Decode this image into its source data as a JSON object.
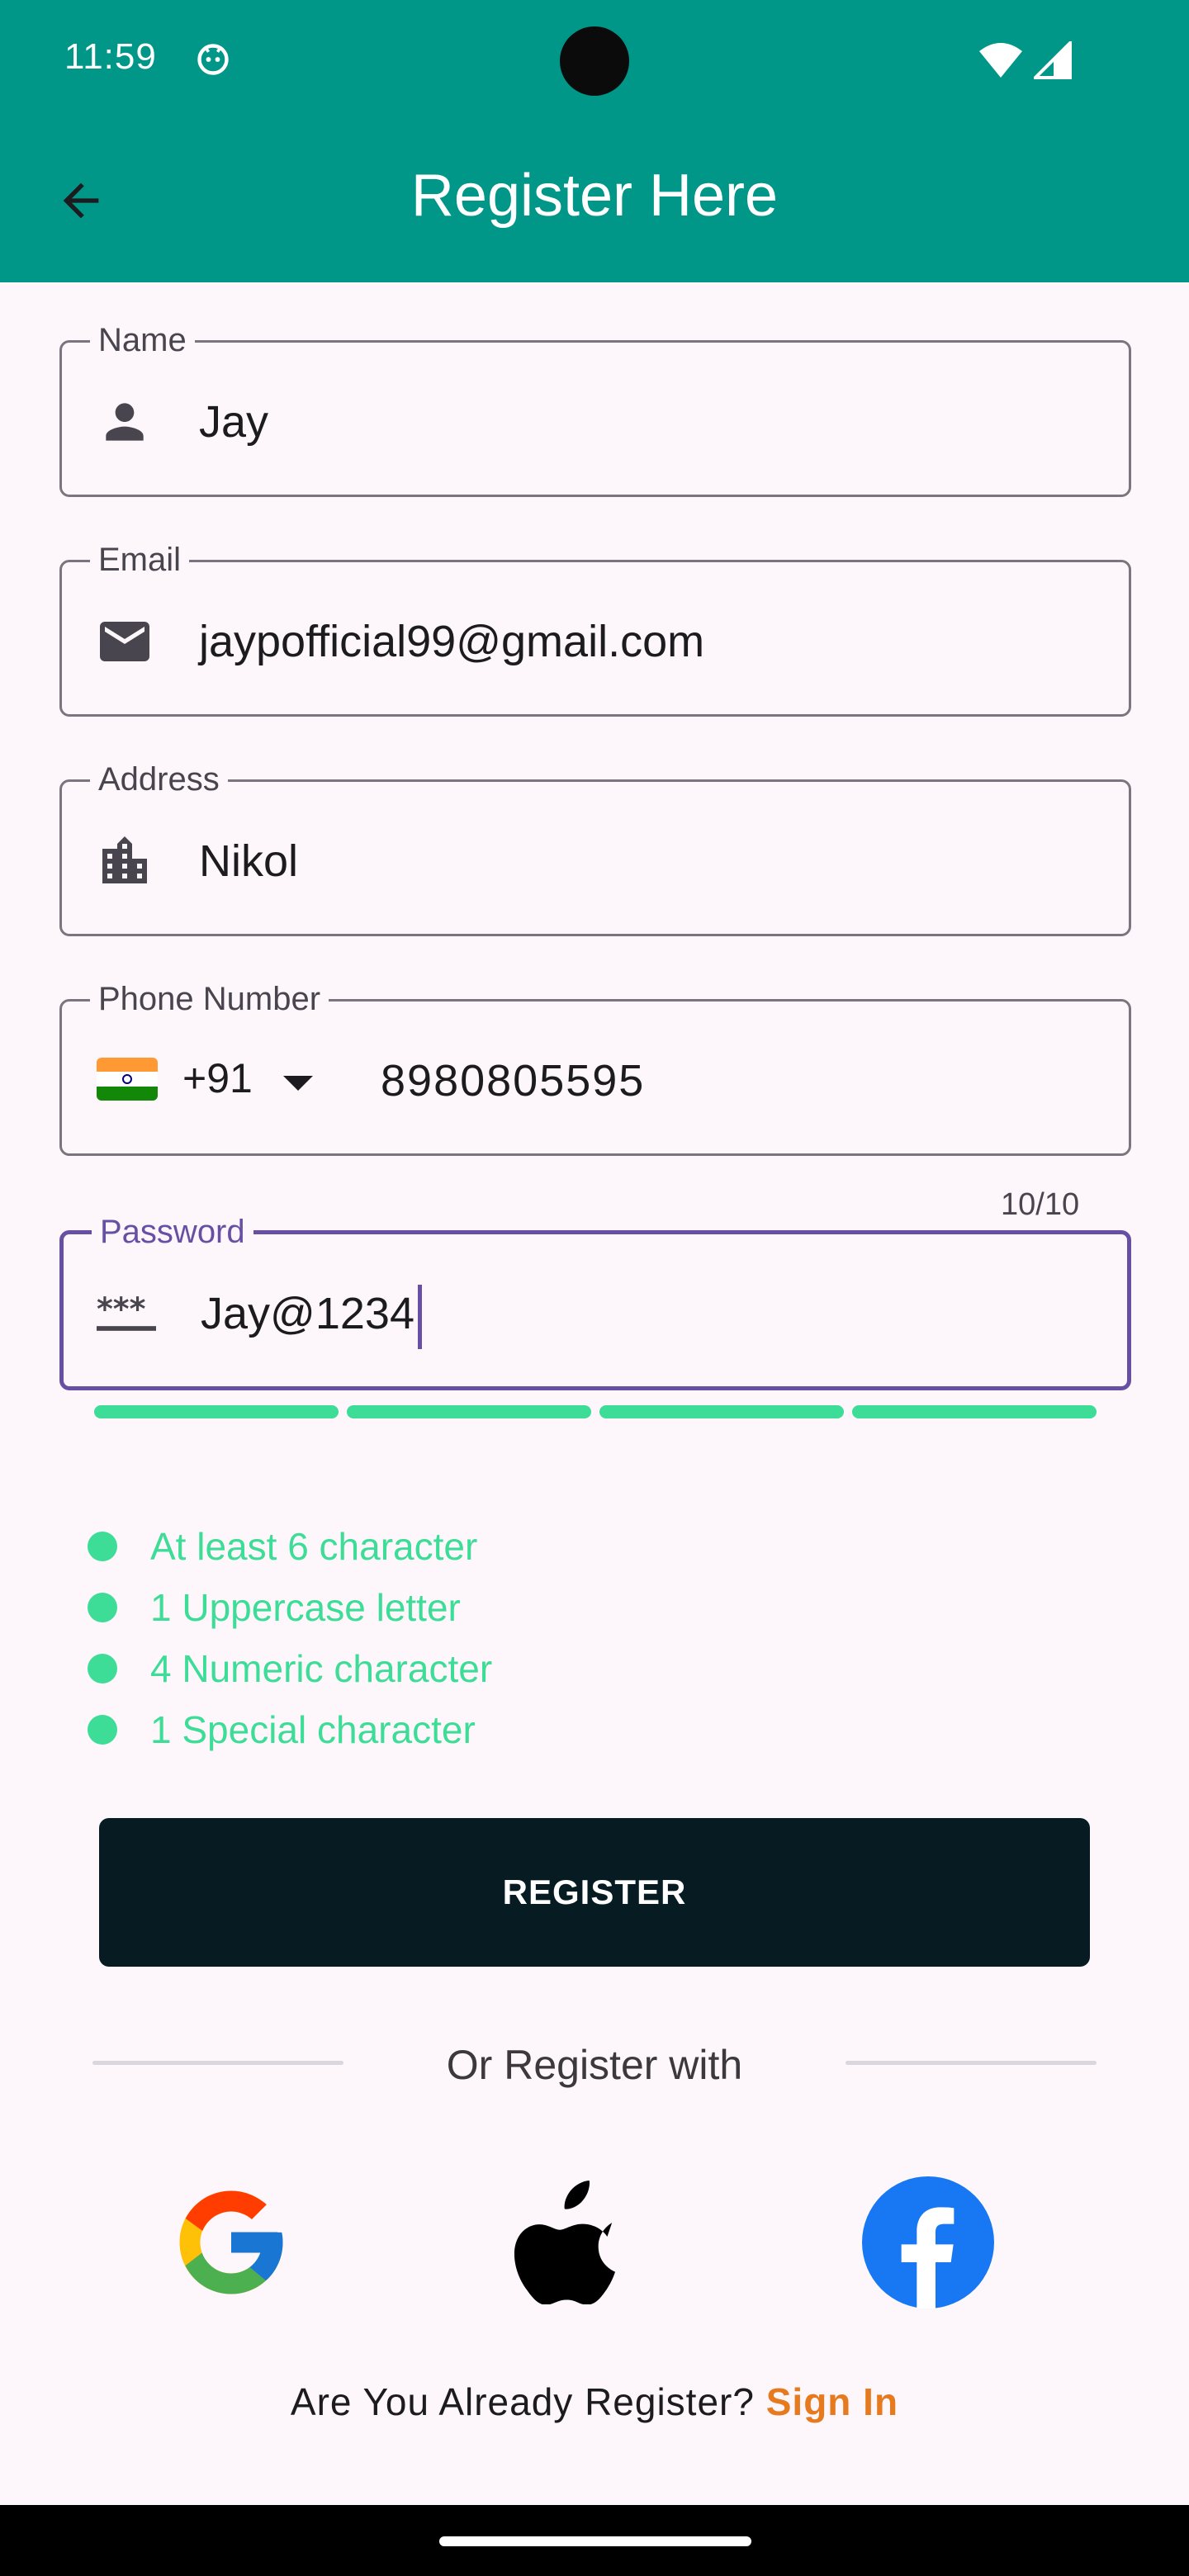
{
  "status_bar": {
    "time": "11:59"
  },
  "app_bar": {
    "title": "Register Here"
  },
  "form": {
    "name": {
      "label": "Name",
      "value": "Jay"
    },
    "email": {
      "label": "Email",
      "value": "jaypofficial99@gmail.com"
    },
    "address": {
      "label": "Address",
      "value": "Nikol"
    },
    "phone": {
      "label": "Phone Number",
      "country_code": "+91",
      "value": "8980805595"
    },
    "password": {
      "label": "Password",
      "value": "Jay@1234",
      "counter": "10/10",
      "strength_fraction": 1.0
    }
  },
  "password_requirements": [
    {
      "text": "At least 6 character",
      "met": true
    },
    {
      "text": "1 Uppercase letter",
      "met": true
    },
    {
      "text": "4 Numeric character",
      "met": true
    },
    {
      "text": "1 Special character",
      "met": true
    }
  ],
  "register_button": {
    "label": "REGISTER"
  },
  "social": {
    "divider_text": "Or Register with",
    "providers": [
      "google-icon",
      "apple-icon",
      "facebook-icon"
    ]
  },
  "signin": {
    "prompt": "Are You Already Register?",
    "link": "Sign In"
  },
  "colors": {
    "app_bar": "#009688",
    "accent": "#6750a4",
    "success": "#3ddc97",
    "button": "#061c22",
    "link": "#e57a1f"
  }
}
